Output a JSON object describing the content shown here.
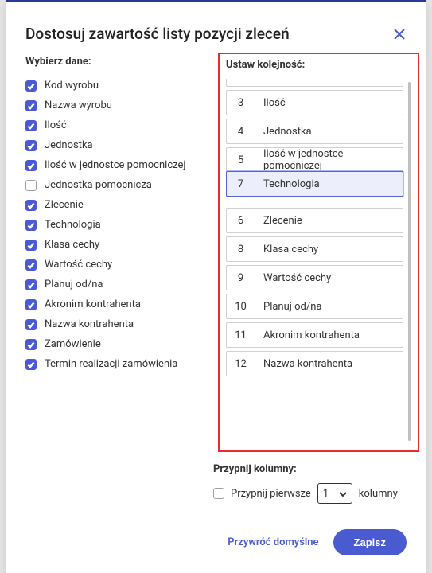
{
  "dialog": {
    "title": "Dostosuj zawartość listy pozycji zleceń"
  },
  "left": {
    "label": "Wybierz dane:",
    "items": [
      {
        "label": "Kod wyrobu",
        "checked": true
      },
      {
        "label": "Nazwa wyrobu",
        "checked": true
      },
      {
        "label": "Ilość",
        "checked": true
      },
      {
        "label": "Jednostka",
        "checked": true
      },
      {
        "label": "Ilość w jednostce pomocniczej",
        "checked": true
      },
      {
        "label": "Jednostka pomocnicza",
        "checked": false
      },
      {
        "label": "Zlecenie",
        "checked": true
      },
      {
        "label": "Technologia",
        "checked": true
      },
      {
        "label": "Klasa cechy",
        "checked": true
      },
      {
        "label": "Wartość cechy",
        "checked": true
      },
      {
        "label": "Planuj od/na",
        "checked": true
      },
      {
        "label": "Akronim kontrahenta",
        "checked": true
      },
      {
        "label": "Nazwa kontrahenta",
        "checked": true
      },
      {
        "label": "Zamówienie",
        "checked": true
      },
      {
        "label": "Termin realizacji zamówienia",
        "checked": true
      }
    ]
  },
  "right": {
    "label": "Ustaw kolejność:",
    "items": [
      {
        "num": "",
        "label": "",
        "variant": "cut-top"
      },
      {
        "num": "3",
        "label": "Ilość"
      },
      {
        "num": "4",
        "label": "Jednostka"
      },
      {
        "num": "5",
        "label": "Ilość w jednostce pomocniczej"
      },
      {
        "num": "7",
        "label": "Technologia",
        "variant": "dragging"
      },
      {
        "variant": "gap"
      },
      {
        "num": "6",
        "label": "Zlecenie"
      },
      {
        "num": "8",
        "label": "Klasa cechy"
      },
      {
        "num": "9",
        "label": "Wartość cechy"
      },
      {
        "num": "10",
        "label": "Planuj od/na"
      },
      {
        "num": "11",
        "label": "Akronim kontrahenta"
      },
      {
        "num": "12",
        "label": "Nazwa kontrahenta"
      }
    ]
  },
  "pin": {
    "label": "Przypnij kolumny:",
    "text_before": "Przypnij pierwsze",
    "value": "1",
    "text_after": "kolumny"
  },
  "footer": {
    "reset": "Przywróć domyślne",
    "save": "Zapisz"
  }
}
